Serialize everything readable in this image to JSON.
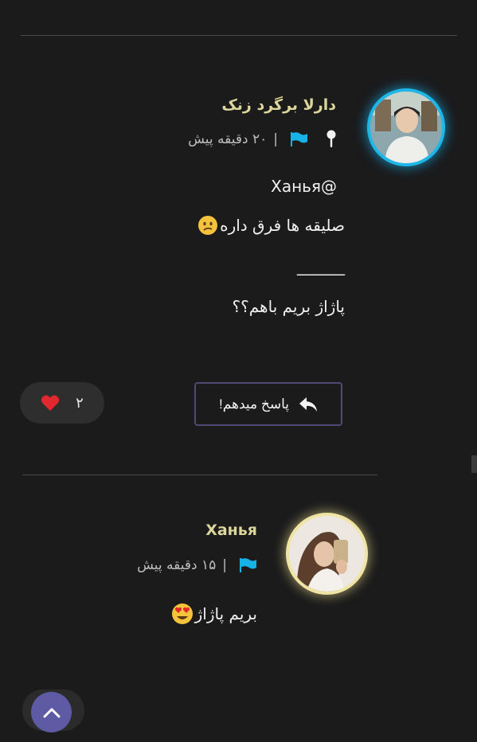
{
  "comments": [
    {
      "author": "دارلا برگرد زنک",
      "time": "۲۰ دقیقه پیش",
      "separator": "|",
      "mention": "Xанья@",
      "line1": "صلیقه ها فرق داره",
      "rule": "______",
      "line2": "پاژاژ بریم باهم؟؟",
      "icons": [
        "pin-icon",
        "flag-icon",
        "confused-emoji-icon"
      ]
    },
    {
      "author": "Xанья",
      "time": "۱۵ دقیقه پیش",
      "separator": "|",
      "text": "بریم پاژاژ",
      "icons": [
        "flag-icon",
        "heart-eyes-emoji-icon"
      ]
    }
  ],
  "actions": {
    "reply_label": "پاسخ میدهم!",
    "like_count": "۲"
  },
  "colors": {
    "background": "#1b1b1c",
    "author_name": "#dcd69a",
    "flag": "#17b3e6",
    "avatar_ring_blue": "#1fb7e8",
    "avatar_ring_gold": "#efe4a3",
    "scroll_button": "#5e5ba4",
    "heart": "#e0282e"
  }
}
